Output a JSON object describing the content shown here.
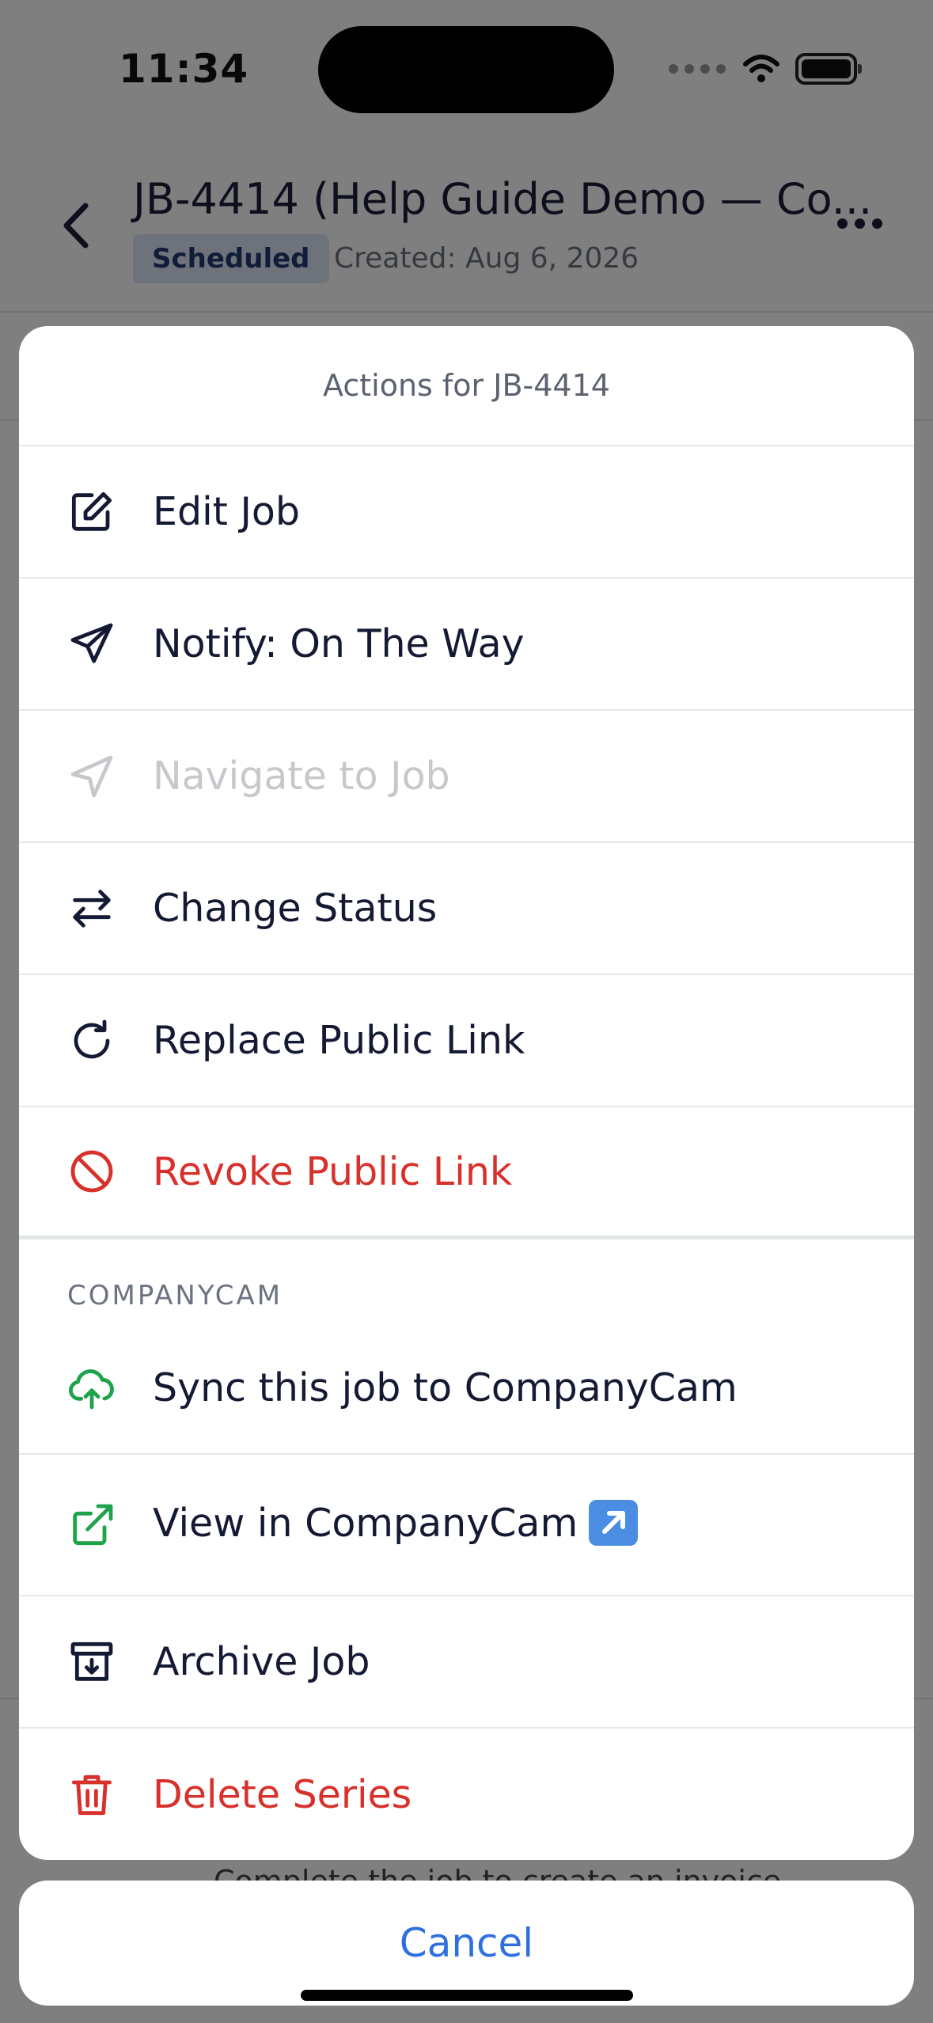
{
  "status_bar": {
    "time": "11:34"
  },
  "header": {
    "title": "JB-4414 (Help Guide Demo — Co...",
    "status_badge": "Scheduled",
    "created": "Created: Aug 6, 2026"
  },
  "background": {
    "peek_text": "Complete the job to create an invoice"
  },
  "sheet": {
    "title": "Actions for JB-4414",
    "actions": [
      {
        "label": "Edit Job",
        "icon": "edit-icon",
        "state": "normal"
      },
      {
        "label": "Notify: On The Way",
        "icon": "send-icon",
        "state": "normal"
      },
      {
        "label": "Navigate to Job",
        "icon": "navigation-icon",
        "state": "disabled"
      },
      {
        "label": "Change Status",
        "icon": "swap-arrows-icon",
        "state": "normal"
      },
      {
        "label": "Replace Public Link",
        "icon": "refresh-icon",
        "state": "normal"
      },
      {
        "label": "Revoke Public Link",
        "icon": "ban-icon",
        "state": "danger"
      }
    ],
    "section_label": "COMPANYCAM",
    "companycam_actions": [
      {
        "label": "Sync this job to CompanyCam",
        "icon": "cloud-upload-icon"
      },
      {
        "label": "View in CompanyCam",
        "icon": "external-link-icon",
        "badge_icon": "up-right-arrow-emoji-icon"
      }
    ],
    "more_actions": [
      {
        "label": "Archive Job",
        "icon": "archive-icon",
        "state": "normal"
      },
      {
        "label": "Delete Series",
        "icon": "trash-icon",
        "state": "danger"
      }
    ]
  },
  "cancel_label": "Cancel",
  "colors": {
    "primary_text": "#141a33",
    "danger": "#d8302b",
    "disabled": "#c6c8cc",
    "companycam_green": "#1ea34a",
    "cancel_blue": "#2f6fe0",
    "badge_bg": "#dde6f6"
  }
}
